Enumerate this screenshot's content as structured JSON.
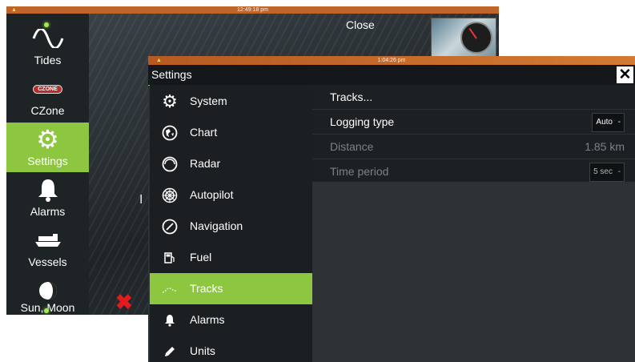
{
  "back_screen": {
    "time": "12:49:18 pm",
    "close_label": "Close",
    "partial_text": "I",
    "sidebar": [
      {
        "label": "Tides",
        "icon": "sine-wave-icon",
        "selected": false
      },
      {
        "label": "CZone",
        "icon": "czone-logo-icon",
        "logo_text": "CZONE",
        "selected": false
      },
      {
        "label": "Settings",
        "icon": "gear-icon",
        "selected": true
      },
      {
        "label": "Alarms",
        "icon": "bell-icon",
        "selected": false
      },
      {
        "label": "Vessels",
        "icon": "ship-icon",
        "selected": false
      },
      {
        "label": "Sun, Moon",
        "icon": "moon-phase-icon",
        "selected": false
      }
    ]
  },
  "dialog": {
    "time": "1:04:26 pm",
    "title": "Settings",
    "close_icon": "close-icon",
    "menu": [
      {
        "label": "System",
        "icon": "gear-icon",
        "selected": false
      },
      {
        "label": "Chart",
        "icon": "globe-icon",
        "selected": false
      },
      {
        "label": "Radar",
        "icon": "radar-icon",
        "selected": false
      },
      {
        "label": "Autopilot",
        "icon": "helm-icon",
        "selected": false
      },
      {
        "label": "Navigation",
        "icon": "compass-icon",
        "selected": false
      },
      {
        "label": "Fuel",
        "icon": "fuel-pump-icon",
        "selected": false
      },
      {
        "label": "Tracks",
        "icon": "track-icon",
        "selected": true
      },
      {
        "label": "Alarms",
        "icon": "bell-icon",
        "selected": false
      },
      {
        "label": "Units",
        "icon": "pencil-icon",
        "selected": false
      }
    ],
    "panel": {
      "tracks_label": "Tracks...",
      "logging_type_label": "Logging type",
      "logging_type_value": "Auto",
      "distance_label": "Distance",
      "distance_value": "1.85 km",
      "time_period_label": "Time period",
      "time_period_value": "5 sec"
    }
  },
  "colors": {
    "accent": "#8dc63f",
    "topbar": "#c0652a",
    "alert": "#e21c1c"
  }
}
